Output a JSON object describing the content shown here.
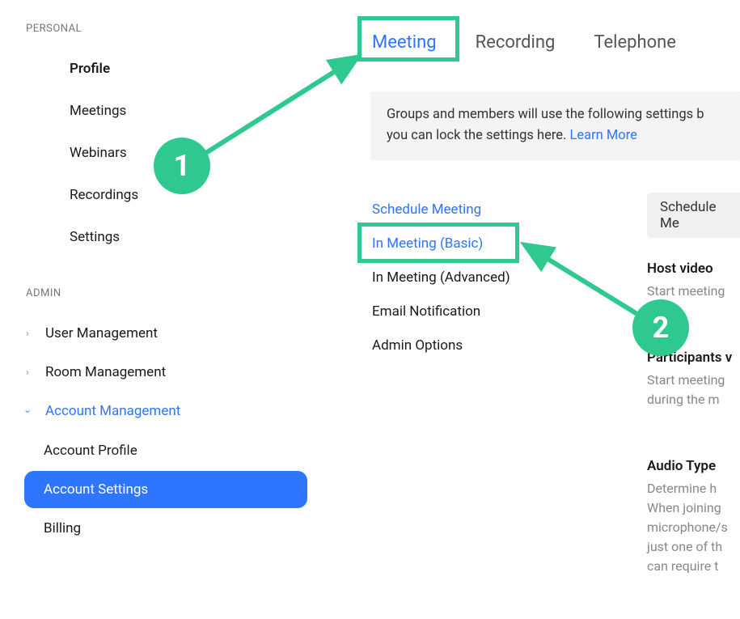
{
  "sidebar": {
    "personal_header": "PERSONAL",
    "personal_items": [
      {
        "label": "Profile"
      },
      {
        "label": "Meetings"
      },
      {
        "label": "Webinars"
      },
      {
        "label": "Recordings"
      },
      {
        "label": "Settings"
      }
    ],
    "admin_header": "ADMIN",
    "admin_items": [
      {
        "label": "User Management",
        "expanded": false
      },
      {
        "label": "Room Management",
        "expanded": false
      },
      {
        "label": "Account Management",
        "expanded": true
      }
    ],
    "account_sub_items": [
      {
        "label": "Account Profile",
        "active": false
      },
      {
        "label": "Account Settings",
        "active": true
      },
      {
        "label": "Billing",
        "active": false
      }
    ]
  },
  "tabs": [
    {
      "label": "Meeting",
      "active": true
    },
    {
      "label": "Recording",
      "active": false
    },
    {
      "label": "Telephone",
      "active": false
    }
  ],
  "info_box": {
    "text1": "Groups and members will use the following settings b",
    "text2": "you can lock the settings here. ",
    "link": "Learn More"
  },
  "sub_nav": [
    {
      "label": "Schedule Meeting",
      "link": true
    },
    {
      "label": "In Meeting (Basic)",
      "link": true,
      "highlighted": true
    },
    {
      "label": "In Meeting (Advanced)",
      "link": false
    },
    {
      "label": "Email Notification",
      "link": false
    },
    {
      "label": "Admin Options",
      "link": false
    }
  ],
  "settings": {
    "section_header": "Schedule Me",
    "items": [
      {
        "title": "Host video",
        "desc": "Start meeting"
      },
      {
        "title": "Participants v",
        "desc": "Start meeting during the m"
      },
      {
        "title": "Audio Type",
        "desc": "Determine h When joining microphone/s just one of th can require t"
      }
    ]
  },
  "annotations": {
    "circle1": "1",
    "circle2": "2"
  },
  "colors": {
    "accent_blue": "#2e75ff",
    "highlight_green": "#2fc98f"
  }
}
